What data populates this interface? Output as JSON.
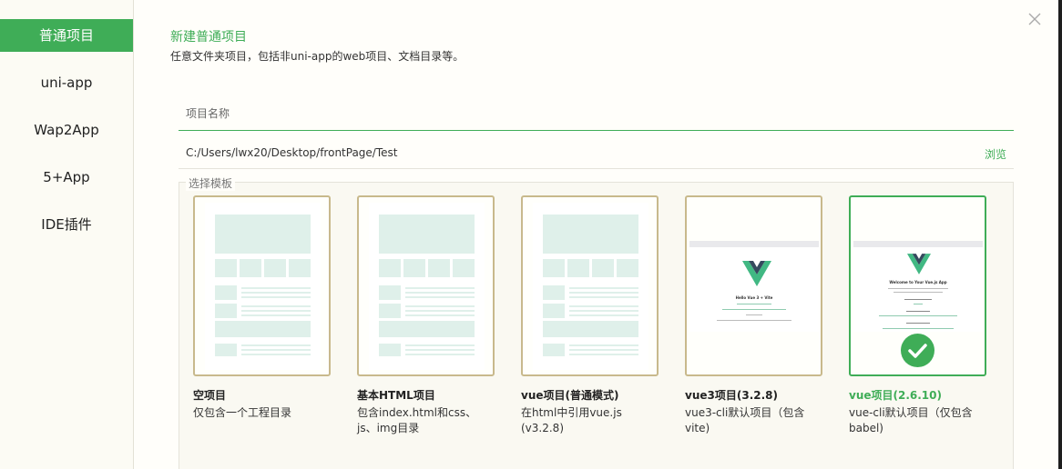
{
  "sidebar": {
    "items": [
      {
        "label": "普通项目",
        "active": true
      },
      {
        "label": "uni-app"
      },
      {
        "label": "Wap2App"
      },
      {
        "label": "5+App"
      },
      {
        "label": "IDE插件"
      }
    ]
  },
  "header": {
    "title": "新建普通项目",
    "subtitle": "任意文件夹项目，包括非uni-app的web项目、文档目录等。"
  },
  "form": {
    "name_placeholder": "项目名称",
    "name_value": "",
    "path_value": "C:/Users/lwx20/Desktop/frontPage/Test",
    "browse_label": "浏览"
  },
  "templates": {
    "legend": "选择模板",
    "items": [
      {
        "name": "空项目",
        "desc": "仅包含一个工程目录"
      },
      {
        "name": "基本HTML项目",
        "desc": "包含index.html和css、js、img目录"
      },
      {
        "name": "vue项目(普通模式)",
        "desc": "在html中引用vue.js (v3.2.8)"
      },
      {
        "name": "vue3项目(3.2.8)",
        "desc": "vue3-cli默认项目（包含vite)",
        "preview_heading": "Hello Vue 3 + Vite"
      },
      {
        "name": "vue项目(2.6.10)",
        "desc": "vue-cli默认项目（仅包含babel)",
        "selected": true,
        "preview_heading": "Welcome to Your Vue.js App"
      }
    ]
  },
  "colors": {
    "accent": "#3fad57",
    "card_border": "#c8b98c",
    "wireframe": "#dff0ea"
  }
}
